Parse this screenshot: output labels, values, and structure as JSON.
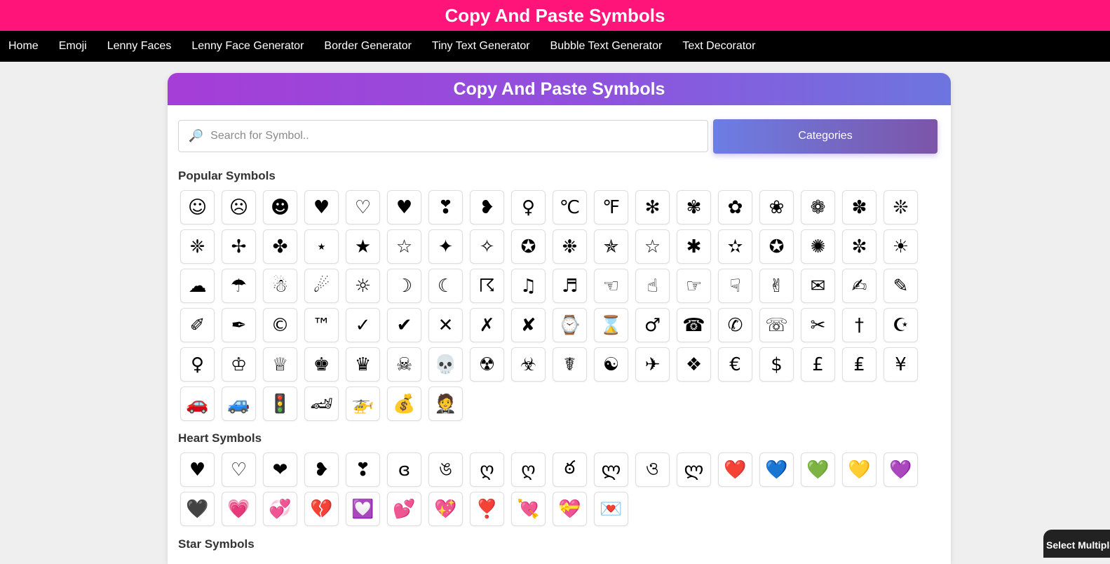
{
  "site_title": "Copy And Paste Symbols",
  "nav": [
    "Home",
    "Emoji",
    "Lenny Faces",
    "Lenny Face Generator",
    "Border Generator",
    "Tiny Text Generator",
    "Bubble Text Generator",
    "Text Decorator"
  ],
  "card_title": "Copy And Paste Symbols",
  "search": {
    "placeholder": "Search for Symbol..",
    "icon": "search-icon"
  },
  "categories_label": "Categories",
  "sections": [
    {
      "title": "Popular Symbols",
      "symbols": [
        "☺",
        "☹",
        "☻",
        "♥",
        "♡",
        "♥",
        "❣",
        "❥",
        "♀",
        "℃",
        "℉",
        "✻",
        "✾",
        "✿",
        "❀",
        "❁",
        "✽",
        "❊",
        "❈",
        "✢",
        "✤",
        "⋆",
        "★",
        "☆",
        "✦",
        "✧",
        "✪",
        "❉",
        "✯",
        "☆",
        "✱",
        "✫",
        "✪",
        "✺",
        "✼",
        "☀",
        "☁",
        "☂",
        "☃",
        "☄",
        "☼",
        "☽",
        "☾",
        "☈",
        "♫",
        "♬",
        "☜",
        "☝",
        "☞",
        "☟",
        "✌",
        "✉",
        "✍",
        "✎",
        "✐",
        "✒",
        "©",
        "™",
        "✓",
        "✔",
        "✕",
        "✗",
        "✘",
        "⌚",
        "⌛",
        "♂",
        "☎",
        "✆",
        "☏",
        "✂",
        "†",
        "☪",
        "♀",
        "♔",
        "♕",
        "♚",
        "♛",
        "☠",
        "💀",
        "☢",
        "☣",
        "☤",
        "☯",
        "✈",
        "❖",
        "€",
        "$",
        "£",
        "₤",
        "¥",
        "🚗",
        "🚙",
        "🚦",
        "🏎",
        "🚁",
        "💰",
        "🤵"
      ]
    },
    {
      "title": "Heart Symbols",
      "symbols": [
        "♥",
        "♡",
        "❤",
        "❥",
        "❣",
        "ɞ",
        "ঙ",
        "ღ",
        "ღ",
        "ఠ",
        "ლ",
        "ও",
        "ლ",
        "❤️",
        "💙",
        "💚",
        "💛",
        "💜",
        "🖤",
        "💗",
        "💞",
        "💔",
        "💟",
        "💕",
        "💖",
        "❣️",
        "💘",
        "💝",
        "💌"
      ]
    },
    {
      "title": "Star Symbols",
      "symbols": []
    }
  ],
  "select_multiple_label": "Select Multiple"
}
